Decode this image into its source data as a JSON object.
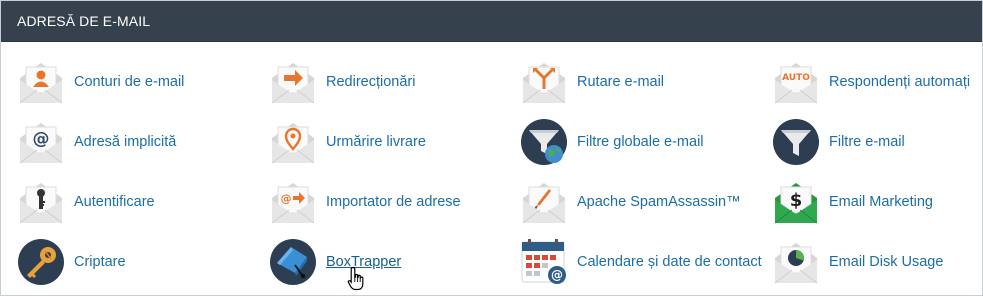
{
  "section": {
    "title": "ADRESĂ DE E-MAIL"
  },
  "items": [
    {
      "label": "Conturi de e-mail",
      "icon": "envelope-user-icon"
    },
    {
      "label": "Redirecționări",
      "icon": "envelope-forward-icon"
    },
    {
      "label": "Rutare e-mail",
      "icon": "envelope-routing-icon"
    },
    {
      "label": "Respondenți automați",
      "icon": "envelope-auto-icon",
      "badge": "AUTO"
    },
    {
      "label": "Adresă implicită",
      "icon": "envelope-at-icon"
    },
    {
      "label": "Urmărire livrare",
      "icon": "envelope-location-icon"
    },
    {
      "label": "Filtre globale e-mail",
      "icon": "global-filter-icon"
    },
    {
      "label": "Filtre e-mail",
      "icon": "funnel-filter-icon"
    },
    {
      "label": "Autentificare",
      "icon": "envelope-key-icon"
    },
    {
      "label": "Importator de adrese",
      "icon": "envelope-import-icon"
    },
    {
      "label": "Apache SpamAssassin™",
      "icon": "envelope-spam-icon"
    },
    {
      "label": "Email Marketing",
      "icon": "email-marketing-dollar-icon",
      "badge": "$"
    },
    {
      "label": "Criptare",
      "icon": "encryption-keys-icon"
    },
    {
      "label": "BoxTrapper",
      "icon": "boxtrapper-icon"
    },
    {
      "label": "Calendare și date de contact",
      "icon": "calendar-contacts-icon"
    },
    {
      "label": "Email Disk Usage",
      "icon": "envelope-disk-usage-icon"
    }
  ],
  "colors": {
    "header_bg": "#35414c",
    "link": "#1b6ea8",
    "orange": "#e8742d",
    "envelope_gray": "#d8d8d8",
    "navy": "#2d3e52",
    "green": "#2fa84f"
  }
}
